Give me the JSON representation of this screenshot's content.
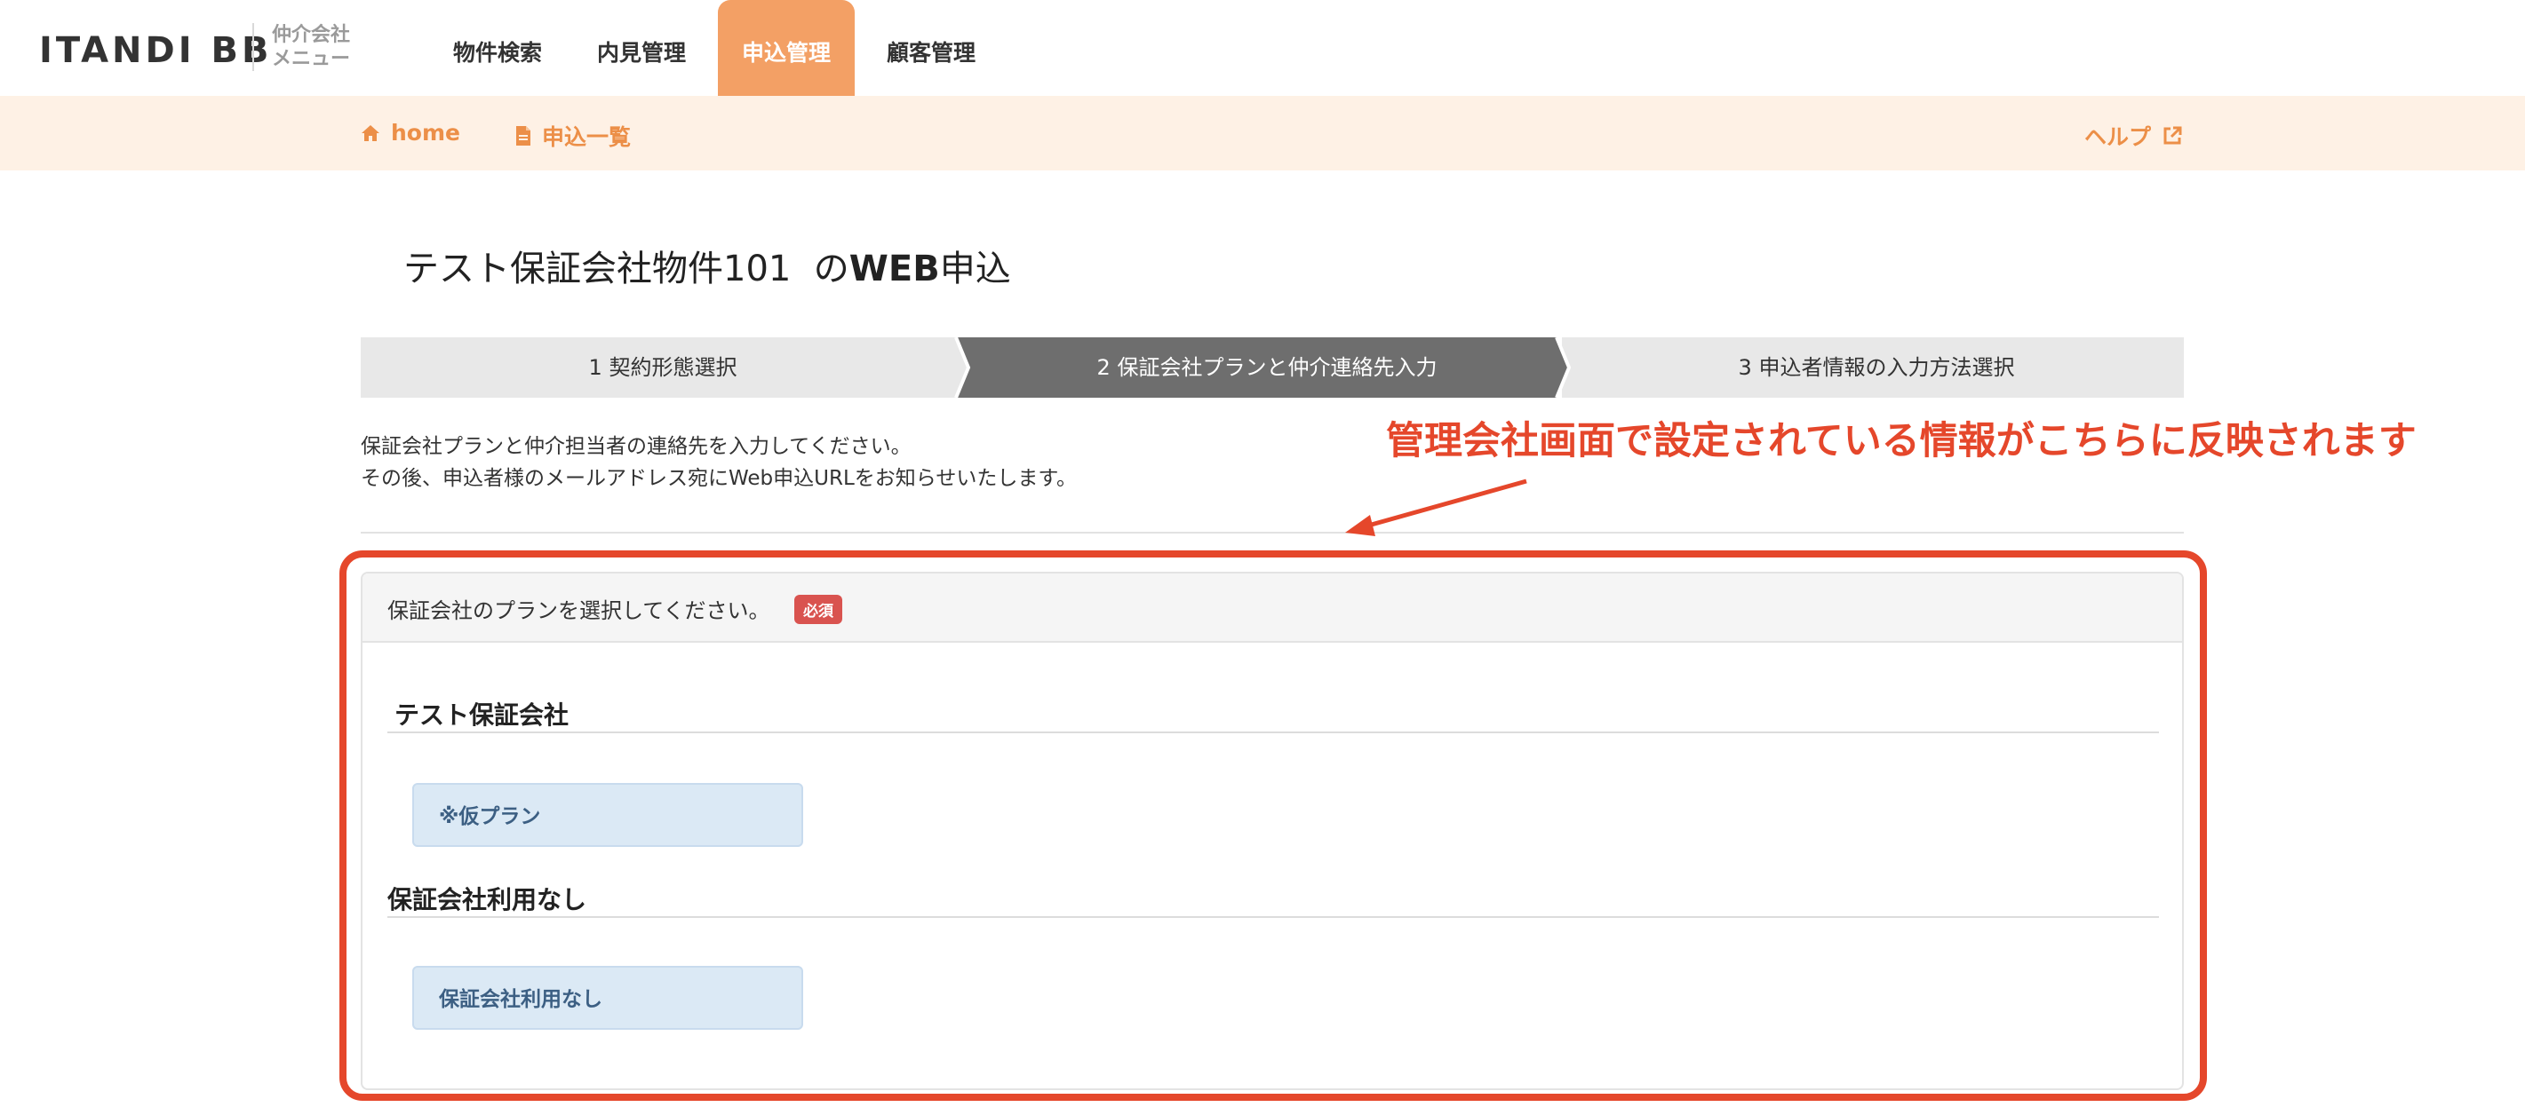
{
  "header": {
    "logo": "ITANDI BB",
    "logo_sub_line1": "仲介会社",
    "logo_sub_line2": "メニュー",
    "nav": [
      {
        "label": "物件検索"
      },
      {
        "label": "内見管理"
      },
      {
        "label": "申込管理",
        "active": true
      },
      {
        "label": "顧客管理"
      }
    ]
  },
  "subnav": {
    "home": "home",
    "list": "申込一覧",
    "help": "ヘルプ"
  },
  "page": {
    "title_property": "テスト保証会社物件101",
    "title_suffix_web": "WEB",
    "title_no": "の",
    "title_suffix_end": "申込"
  },
  "steps": [
    {
      "label": "1 契約形態選択",
      "active": false
    },
    {
      "label": "2 保証会社プランと仲介連絡先入力",
      "active": true
    },
    {
      "label": "3 申込者情報の入力方法選択",
      "active": false
    }
  ],
  "intro": {
    "line1": "保証会社プランと仲介担当者の連絡先を入力してください。",
    "line2": "その後、申込者様のメールアドレス宛にWeb申込URLをお知らせいたします。"
  },
  "annotation": {
    "text": "管理会社画面で設定されている情報がこちらに反映されます",
    "color": "#e5472b"
  },
  "panel": {
    "heading": "保証会社のプランを選択してください。",
    "required_badge": "必須",
    "groups": [
      {
        "title": "テスト保証会社",
        "plans": [
          "※仮プラン"
        ]
      },
      {
        "title": "保証会社利用なし",
        "plans": [
          "保証会社利用なし"
        ]
      }
    ]
  },
  "colors": {
    "accent": "#f3a065",
    "subnav_bg": "#fef1e5",
    "step_active": "#6e6e6e",
    "step_inactive": "#e8e8e8",
    "plan_bg": "#dbe9f5"
  }
}
